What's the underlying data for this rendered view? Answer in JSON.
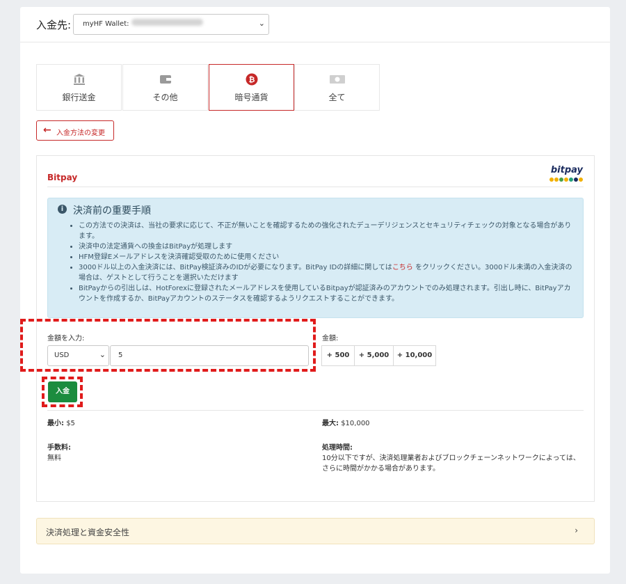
{
  "header": {
    "destination_label": "入金先:",
    "wallet_select_value": "myHF Wallet:",
    "chevron": "⌄"
  },
  "tabs": [
    {
      "label": "銀行送金",
      "icon": "bank-icon"
    },
    {
      "label": "その他",
      "icon": "wallet-icon"
    },
    {
      "label": "暗号通貨",
      "icon": "bitcoin-icon",
      "active": true
    },
    {
      "label": "全て",
      "icon": "cash-icon"
    }
  ],
  "back_button": {
    "label": "入金方法の変更",
    "arrow": "🡐"
  },
  "panel": {
    "title": "Bitpay",
    "logo_text": "bitpay",
    "info": {
      "title": "決済前の重要手順",
      "items": [
        "この方法での決済は、当社の要求に応じて、不正が無いことを確認するための強化されたデューデリジェンスとセキュリティチェックの対象となる場合があります。",
        "決済中の法定通貨への換金はBitPayが処理します",
        "HFM登録Eメールアドレスを決済確認受取のために使用ください",
        "3000ドル以上の入金決済には、BitPay検証済みのIDが必要になります。BitPay IDの詳細に関しては",
        "BitPayからの引出しは、HotForexに登録されたメールアドレスを使用しているBitpayが認証済みのアカウントでのみ処理されます。引出し時に、BitPayアカウントを作成するか、BitPayアカウントのステータスを確認するようリクエストすることができます。"
      ],
      "link_text": "こちら",
      "item4_suffix": "をクリックください。3000ドル未満の入金決済の場合は、ゲストとして行うことを選択いただけます"
    },
    "amount": {
      "label": "金額を入力:",
      "currency": "USD",
      "value": "5"
    },
    "quick_amounts": {
      "label": "金額:",
      "buttons": [
        "+ 500",
        "+ 5,000",
        "+ 10,000"
      ]
    },
    "deposit_button": "入金",
    "min_label": "最小:",
    "min_value": "$5",
    "max_label": "最大:",
    "max_value": "$10,000",
    "fee_label": "手数料:",
    "fee_value": "無料",
    "time_label": "処理時間:",
    "time_value_1": "10分以下ですが、決済処理業者およびブロックチェーンネットワークによっては、",
    "time_value_2": "さらに時間がかかる場合があります。"
  },
  "accordion": {
    "label": "決済処理と資金安全性",
    "chevron": "›"
  },
  "colors": {
    "accent": "#c62828",
    "primary_button": "#1b8c3e",
    "info_bg": "#d8ecf5",
    "highlight": "#e01b1b"
  }
}
